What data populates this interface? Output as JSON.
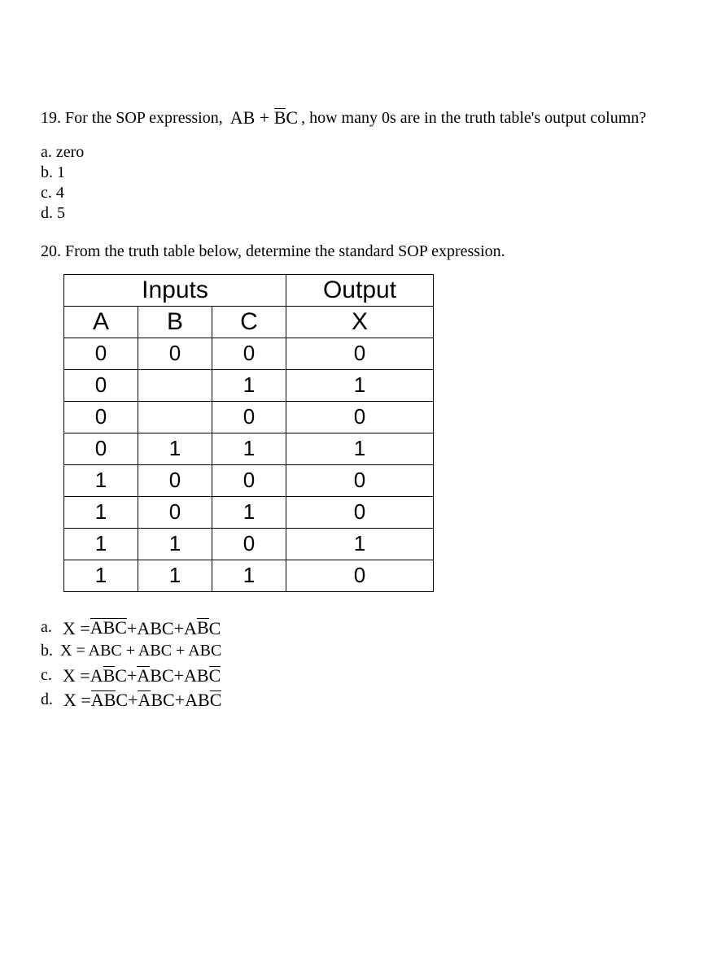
{
  "q19": {
    "number": "19.",
    "text_before": " For the SOP expression, ",
    "expression": {
      "t1": "AB",
      "plus": " + ",
      "t2_bar": "B",
      "t2_rest": "C"
    },
    "text_after": ", how many 0s are in the truth table's output column?",
    "options": [
      {
        "label": "a. ",
        "text": "zero"
      },
      {
        "label": "b. ",
        "text": "1"
      },
      {
        "label": "c. ",
        "text": "4"
      },
      {
        "label": "d. ",
        "text": "5"
      }
    ]
  },
  "q20": {
    "number": "20.",
    "text": " From the truth table below, determine the standard SOP expression.",
    "table": {
      "inputs_header": "Inputs",
      "output_header": "Output",
      "cols": [
        "A",
        "B",
        "C",
        "X"
      ],
      "rows": [
        [
          "0",
          "0",
          "0",
          "0"
        ],
        [
          "0",
          "",
          "1",
          "1"
        ],
        [
          "0",
          "",
          "0",
          "0"
        ],
        [
          "0",
          "1",
          "1",
          "1"
        ],
        [
          "1",
          "0",
          "0",
          "0"
        ],
        [
          "1",
          "0",
          "1",
          "0"
        ],
        [
          "1",
          "1",
          "0",
          "1"
        ],
        [
          "1",
          "1",
          "1",
          "0"
        ]
      ]
    },
    "options": {
      "a": {
        "label": "a. ",
        "lhs": "X = ",
        "t1": {
          "p1_bar": "A",
          "p2_bar": "B",
          "p3_bar": "C"
        },
        "plus1": " + ",
        "t2": {
          "plain": "ABC"
        },
        "plus2": " + ",
        "t3": {
          "p1": "A",
          "p2_bar": "B",
          "p3": "C"
        }
      },
      "b": {
        "label": "b. ",
        "plain": "X = ABC + ABC + ABC"
      },
      "c": {
        "label": "c. ",
        "lhs": "X = ",
        "t1": {
          "p1": "A",
          "p2_bar": "B",
          "p3": "C"
        },
        "plus1": " + ",
        "t2": {
          "p1_bar": "A",
          "p2": "BC"
        },
        "plus2": " + ",
        "t3": {
          "p1": "AB",
          "p2_bar": "C"
        }
      },
      "d": {
        "label": "d. ",
        "lhs": "X = ",
        "t1": {
          "p1_bar": "A",
          "p2_bar": "B",
          "p3": "C"
        },
        "plus1": " + ",
        "t2": {
          "p1_bar": "A",
          "p2": "BC"
        },
        "plus2": " + ",
        "t3": {
          "p1": "AB",
          "p2_bar": "C"
        }
      }
    }
  }
}
